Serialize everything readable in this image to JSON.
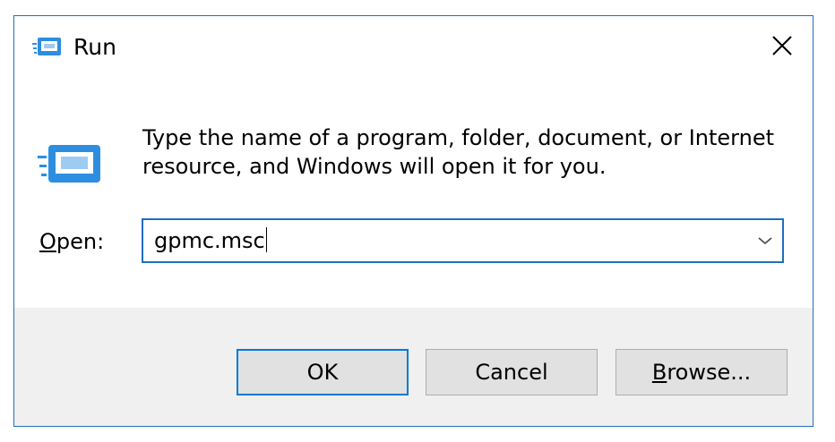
{
  "window": {
    "title": "Run",
    "icon": "run-icon",
    "close_icon": "close-icon"
  },
  "content": {
    "description": "Type the name of a program, folder, document, or Internet resource, and Windows will open it for you.",
    "open_label_accel": "O",
    "open_label_rest": "pen:",
    "open_value": "gpmc.msc",
    "dropdown_icon": "chevron-down-icon"
  },
  "buttons": {
    "ok_label": "OK",
    "cancel_label": "Cancel",
    "browse_accel": "B",
    "browse_rest": "rowse..."
  },
  "colors": {
    "border": "#1f6fbf",
    "footer_bg": "#f0f0f0",
    "button_bg": "#e1e1e1",
    "default_button_border": "#0078d7",
    "icon_blue": "#2d8ee0"
  }
}
